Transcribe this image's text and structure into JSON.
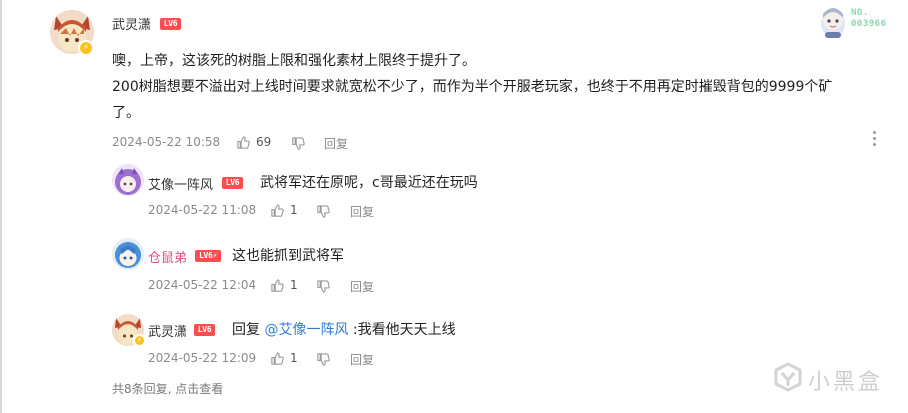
{
  "comment": {
    "username": "武灵潇",
    "level": "LV6",
    "text_lines": [
      "噢，上帝，这该死的树脂上限和强化素材上限终于提升了。",
      "200树脂想要不溢出对上线时间要求就宽松不少了，而作为半个开服老玩家，也终于不用再定时摧毁背包的9999个矿",
      "了。"
    ],
    "date": "2024-05-22 10:58",
    "likes": "69",
    "reply_label": "回复",
    "avatar_badge": "⚡"
  },
  "decoration": {
    "label": "NO.",
    "number": "003966"
  },
  "replies": [
    {
      "username": "艾像一阵风",
      "level": "LV6",
      "text": "武将军还在原呢，c哥最近还在玩吗",
      "date": "2024-05-22 11:08",
      "likes": "1",
      "reply_label": "回复"
    },
    {
      "username": "仓鼠弟",
      "level": "LV6⚡",
      "text": "这也能抓到武将军",
      "date": "2024-05-22 12:04",
      "likes": "1",
      "reply_label": "回复"
    },
    {
      "username": "武灵潇",
      "level": "LV6",
      "reply_prefix": "回复",
      "mention": "@艾像一阵风",
      "text": ":我看他天天上线",
      "date": "2024-05-22 12:09",
      "likes": "1",
      "reply_label": "回复"
    }
  ],
  "footer": {
    "label": "共8条回复, 点击查看"
  },
  "watermark": {
    "text": "小黑盒"
  },
  "colors": {
    "level_badge": "#ff4d4f",
    "mention": "#2f7bd6",
    "pink_username": "#e0507a",
    "meta_gray": "#8a8a8a"
  },
  "icons": {
    "like": "thumb-up-icon",
    "dislike": "thumb-down-icon",
    "more": "more-vertical-icon",
    "watermark_logo": "heybox-logo-icon"
  }
}
